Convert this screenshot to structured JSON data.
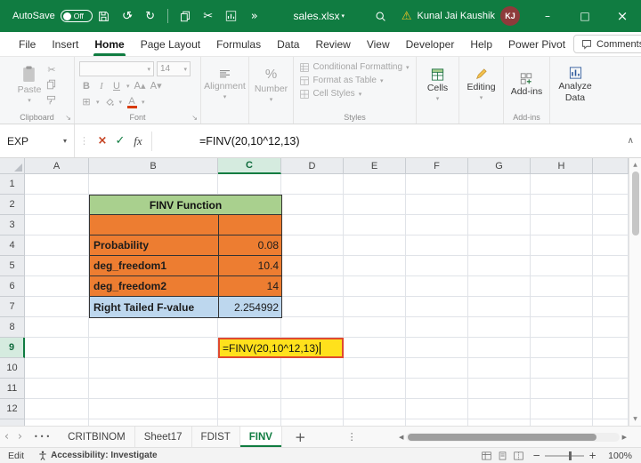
{
  "titlebar": {
    "autosave_label": "AutoSave",
    "autosave_state": "Off",
    "filename": "sales.xlsx",
    "user_name": "Kunal Jai Kaushik",
    "user_initials": "KJ"
  },
  "tabs": {
    "items": [
      {
        "label": "File"
      },
      {
        "label": "Insert"
      },
      {
        "label": "Home"
      },
      {
        "label": "Page Layout"
      },
      {
        "label": "Formulas"
      },
      {
        "label": "Data"
      },
      {
        "label": "Review"
      },
      {
        "label": "View"
      },
      {
        "label": "Developer"
      },
      {
        "label": "Help"
      },
      {
        "label": "Power Pivot"
      }
    ],
    "comments_label": "Comments"
  },
  "ribbon": {
    "paste_label": "Paste",
    "clipboard_group": "Clipboard",
    "font_group": "Font",
    "font_size": "14",
    "alignment_label": "Alignment",
    "number_label": "Number",
    "styles": {
      "conditional_formatting": "Conditional Formatting",
      "format_as_table": "Format as Table",
      "cell_styles": "Cell Styles",
      "group_label": "Styles"
    },
    "cells_label": "Cells",
    "editing_label": "Editing",
    "addins_label": "Add-ins",
    "addins_group": "Add-ins",
    "analyze_label": "Analyze Data"
  },
  "formula_bar": {
    "name_box": "EXP",
    "formula": "=FINV(20,10^12,13)"
  },
  "grid": {
    "columns": [
      "A",
      "B",
      "C",
      "D",
      "E",
      "F",
      "G",
      "H"
    ],
    "row_count": 12,
    "active_column": "C",
    "active_row": 9
  },
  "table": {
    "title": "FINV Function",
    "rows": [
      {
        "label": "",
        "value": ""
      },
      {
        "label": "Probability",
        "value": "0.08"
      },
      {
        "label": "deg_freedom1",
        "value": "10.4"
      },
      {
        "label": "deg_freedom2",
        "value": "14"
      },
      {
        "label": "Right Tailed F-value",
        "value": "2.254992"
      }
    ]
  },
  "edit_cell": {
    "text": "=FINV(20,10^12,13)"
  },
  "sheet_bar": {
    "tabs": [
      {
        "label": "CRITBINOM"
      },
      {
        "label": "Sheet17"
      },
      {
        "label": "FDIST"
      },
      {
        "label": "FINV"
      }
    ]
  },
  "status_bar": {
    "mode": "Edit",
    "accessibility": "Accessibility: Investigate",
    "zoom": "100%"
  },
  "icons": {
    "undo": "↺",
    "redo": "↻",
    "cut": "✂",
    "more_commands": "»",
    "warning": "⚠",
    "minimize": "–",
    "maximize": "□",
    "close": "×",
    "dropdown": "▾",
    "cancel": "×",
    "enter": "✓",
    "fx": "fx",
    "collapse": "∧",
    "resize_dots": "⋮",
    "nav_left": "‹",
    "nav_right": "›",
    "tab_overflow": "•••",
    "add_sheet": "+",
    "tab_menu": "⋮",
    "scroll_left": "◀",
    "scroll_right": "▶",
    "scroll_up": "▲",
    "scroll_down": "▼",
    "percent": "%",
    "borders": "⊞",
    "bold": "B",
    "italic": "I",
    "underline": "U",
    "grow_font": "A▴",
    "shrink_font": "A▾",
    "launcher": "↘",
    "zoom_out": "−",
    "zoom_in": "+"
  },
  "colors": {
    "titlebar_green": "#107C41",
    "table_header_green": "#A9D08E",
    "table_orange": "#ED7D31",
    "table_blue": "#BDD7EE",
    "edit_fill_yellow": "#FFE11C",
    "edit_border_red": "#E0492F"
  }
}
